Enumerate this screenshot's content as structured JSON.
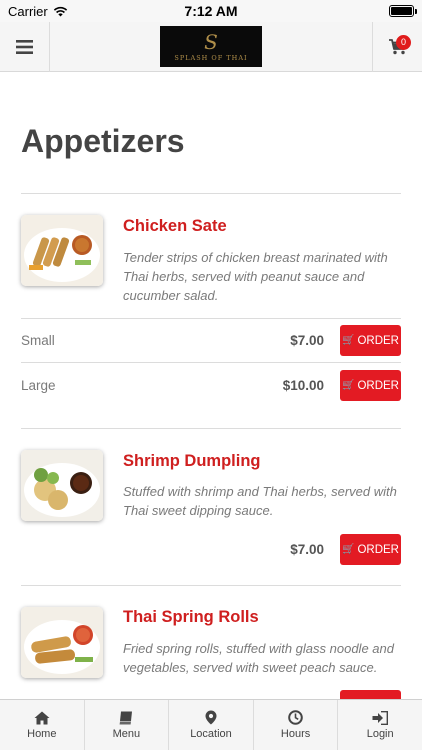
{
  "status_bar": {
    "carrier": "Carrier",
    "time": "7:12 AM"
  },
  "header": {
    "logo_script": "S",
    "logo_text": "SPLASH OF THAI",
    "cart_count": "0"
  },
  "section": {
    "title": "Appetizers"
  },
  "items": [
    {
      "name": "Chicken Sate",
      "description": "Tender strips of chicken breast marinated with Thai herbs, served with peanut sauce and cucumber salad.",
      "prices": [
        {
          "size": "Small",
          "price": "$7.00",
          "order_label": "ORDER"
        },
        {
          "size": "Large",
          "price": "$10.00",
          "order_label": "ORDER"
        }
      ]
    },
    {
      "name": "Shrimp Dumpling",
      "description": "Stuffed with shrimp and Thai herbs, served with Thai sweet dipping sauce.",
      "prices": [
        {
          "size": "",
          "price": "$7.00",
          "order_label": "ORDER"
        }
      ]
    },
    {
      "name": "Thai Spring Rolls",
      "description": "Fried spring rolls, stuffed with glass noodle and vegetables, served with sweet peach sauce.",
      "prices": [
        {
          "size": "",
          "price": "",
          "order_label": ""
        }
      ]
    }
  ],
  "tabs": [
    {
      "label": "Home",
      "icon": "home-icon"
    },
    {
      "label": "Menu",
      "icon": "book-icon"
    },
    {
      "label": "Location",
      "icon": "map-pin-icon"
    },
    {
      "label": "Hours",
      "icon": "clock-icon"
    },
    {
      "label": "Login",
      "icon": "login-icon"
    }
  ],
  "colors": {
    "accent": "#e31b23",
    "item_title": "#cf1f1f",
    "logo_gold": "#b08f4a"
  }
}
